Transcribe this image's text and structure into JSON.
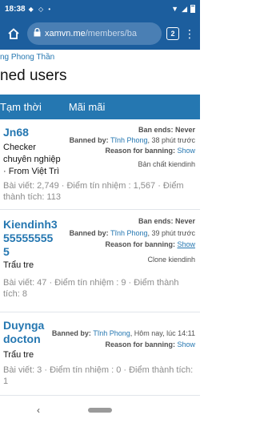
{
  "status_bar": {
    "time": "18:38"
  },
  "browser": {
    "url_host": "xamvn.me",
    "url_path": "/members/ba",
    "tab_count": "2"
  },
  "breadcrumb": "ng Phong Thần",
  "page_title": "ned users",
  "tabs": [
    {
      "label": "Tạm thời"
    },
    {
      "label": "Mãi mãi"
    }
  ],
  "entries": [
    {
      "name_lines": [
        "Jn68"
      ],
      "title_lines": [
        "Checker",
        "chuyên nghiệp",
        "· From Việt Trì"
      ],
      "stats_lines": [
        "Bài viết: 2,749 · Điểm tín nhiệm : 1,567 · Điểm",
        "thành tích: 113"
      ],
      "ban_ends": "Ban ends: Never",
      "banned_by_label": "Banned by:",
      "banned_by_user": "Tĩnh Phong",
      "banned_when": ", 38 phút trước",
      "reason_label": "Reason for banning:",
      "reason_link": "Show",
      "reason": "Bản chất kiendinh"
    },
    {
      "name_lines": [
        "Kiendinh3",
        "55555555",
        "5"
      ],
      "title_lines": [
        "Trẩu tre"
      ],
      "stats_lines": [
        "Bài viết: 47 · Điểm tín nhiệm : 9 · Điểm thành",
        "tích: 8"
      ],
      "ban_ends": "Ban ends: Never",
      "banned_by_label": "Banned by:",
      "banned_by_user": "Tĩnh Phong",
      "banned_when": ", 39 phút trước",
      "reason_label": "Reason for banning:",
      "reason_link": "Show",
      "reason": "Clone kiendinh"
    },
    {
      "name_lines": [
        "Duynga",
        "docton"
      ],
      "title_lines": [
        "Trẩu tre"
      ],
      "stats_lines": [
        "Bài viết: 3 · Điểm tín nhiệm : 0 · Điểm thành tích:",
        "1"
      ],
      "ban_ends": "",
      "banned_by_label": "Banned by:",
      "banned_by_user": "Tĩnh Phong",
      "banned_when": ", Hôm nay, lúc 14:11",
      "reason_label": "Reason for banning:",
      "reason_link": "Show",
      "reason": ""
    }
  ],
  "colors": {
    "header": "#1c5e9e",
    "tabbar": "#2577b1",
    "link": "#2577b1"
  },
  "icons": [
    "home-icon",
    "lock-icon",
    "tabs-icon",
    "kebab-menu-icon",
    "back-icon"
  ]
}
